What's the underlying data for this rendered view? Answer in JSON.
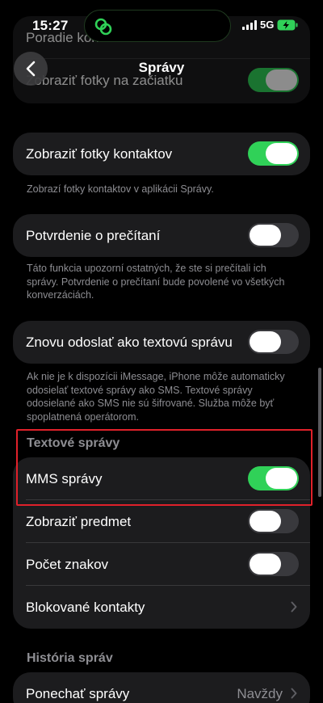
{
  "status": {
    "time": "15:27",
    "network": "5G"
  },
  "nav": {
    "title": "Správy"
  },
  "top_card": {
    "row1": "Poradie kontaktov",
    "row2": "Zobraziť fotky na začiatku"
  },
  "contact_photos": {
    "label": "Zobraziť fotky kontaktov",
    "on": true,
    "footnote": "Zobrazí fotky kontaktov v aplikácii Správy."
  },
  "read_receipts": {
    "label": "Potvrdenie o prečítaní",
    "on": false,
    "footnote": "Táto funkcia upozorní ostatných, že ste si prečítali ich správy. Potvrdenie o prečítaní bude povolené vo všetkých konverzáciách."
  },
  "send_as_sms": {
    "label": "Znovu odoslať ako textovú správu",
    "on": false,
    "footnote": "Ak nie je k dispozícii iMessage, iPhone môže automaticky odosielať textové správy ako SMS. Textové správy odosielané ako SMS nie sú šifrované. Služba môže byť spoplatnená operátorom."
  },
  "text_messages": {
    "header": "Textové správy",
    "mms": {
      "label": "MMS správy",
      "on": true
    },
    "subject": {
      "label": "Zobraziť predmet",
      "on": false
    },
    "char_count": {
      "label": "Počet znakov",
      "on": false
    },
    "blocked": {
      "label": "Blokované kontakty"
    }
  },
  "history": {
    "header": "História správ",
    "keep": {
      "label": "Ponechať správy",
      "value": "Navždy"
    }
  },
  "colors": {
    "toggle_on": "#30d158",
    "toggle_off": "#39393d",
    "highlight": "#e0212a"
  }
}
